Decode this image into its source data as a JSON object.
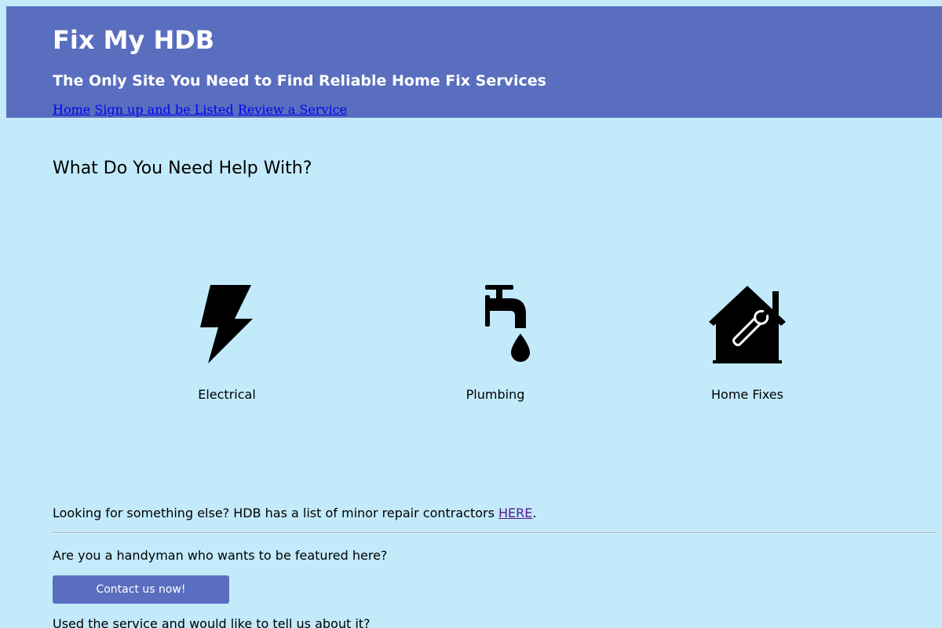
{
  "header": {
    "title": "Fix My HDB",
    "tagline": "The Only Site You Need to Find Reliable Home Fix Services",
    "background_color": "#5a6ebf"
  },
  "nav": {
    "items": [
      {
        "label": "Home"
      },
      {
        "label": "Sign up and be Listed"
      },
      {
        "label": "Review a Service"
      }
    ]
  },
  "main": {
    "heading": "What Do You Need Help With?",
    "services": [
      {
        "label": "Electrical",
        "icon": "lightning-bolt-icon"
      },
      {
        "label": "Plumbing",
        "icon": "faucet-icon"
      },
      {
        "label": "Home Fixes",
        "icon": "house-wrench-icon"
      }
    ]
  },
  "contractors": {
    "prefix": "Looking for something else? HDB has a list of minor repair contractors ",
    "link_label": "HERE",
    "suffix": "."
  },
  "handyman": {
    "question": "Are you a handyman who wants to be featured here?",
    "button_label": "Contact us now!"
  },
  "review": {
    "question": "Used the service and would like to tell us about it?"
  },
  "colors": {
    "page_background": "#c2eafb",
    "accent": "#5a6ebf",
    "link": "#0000ee",
    "visited_link": "#551a8b"
  }
}
